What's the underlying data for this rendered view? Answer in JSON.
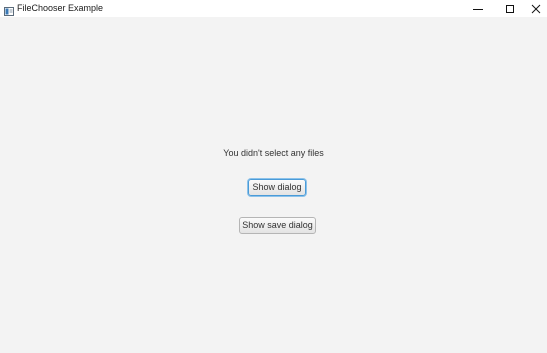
{
  "window": {
    "title": "FileChooser Example",
    "controls": {
      "minimize_icon": "minimize-icon",
      "maximize_icon": "maximize-icon",
      "close_icon": "close-icon"
    }
  },
  "main": {
    "status_text": "You didn't select any files",
    "show_dialog_label": "Show dialog",
    "show_save_dialog_label": "Show save dialog"
  },
  "colors": {
    "background": "#f3f3f3",
    "titlebar": "#ffffff",
    "focus_ring": "#4a9bd8"
  }
}
